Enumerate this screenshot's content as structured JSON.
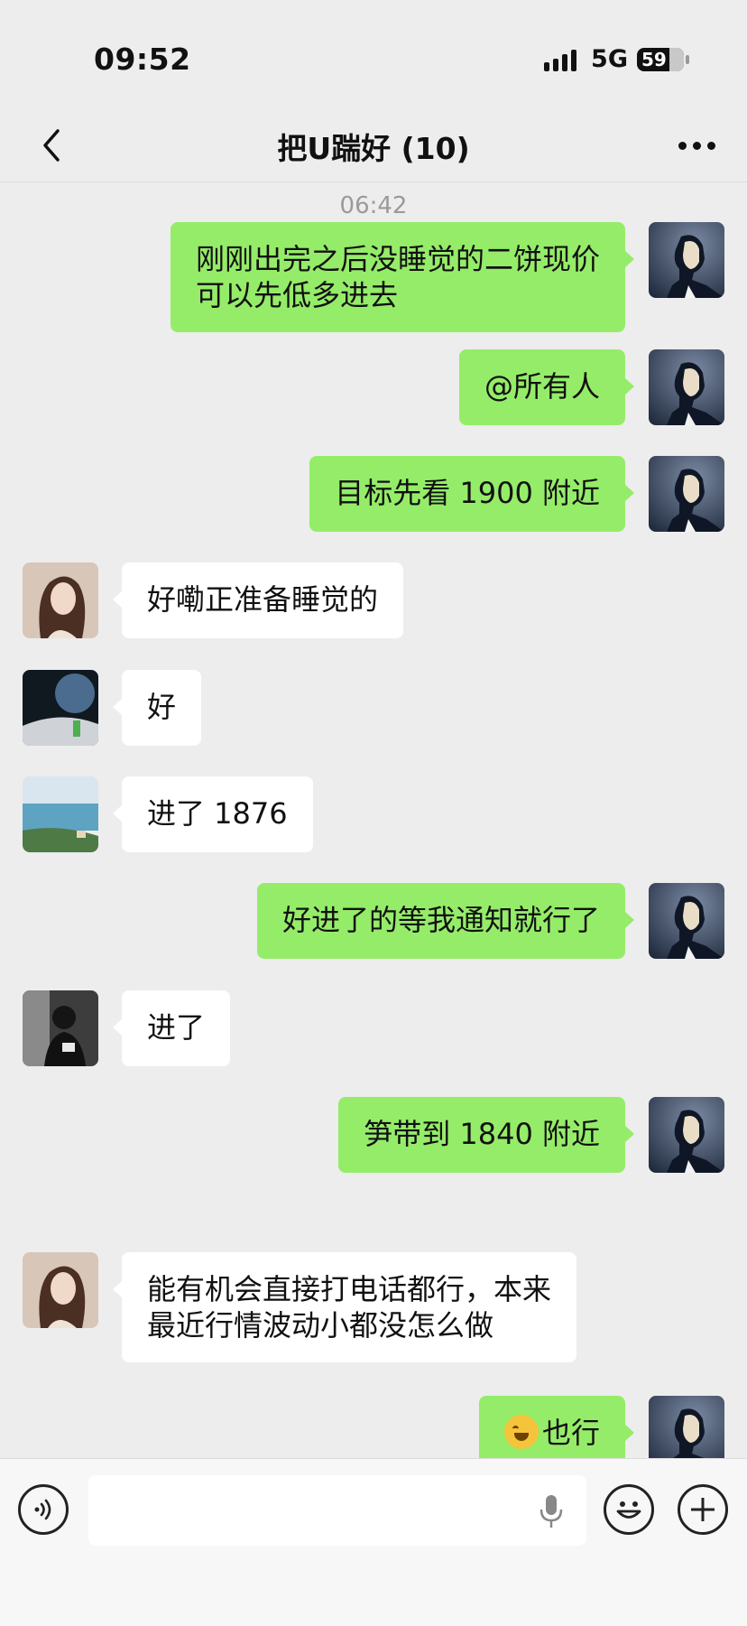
{
  "status_bar": {
    "time": "09:52",
    "network": "5G",
    "battery": "59"
  },
  "header": {
    "title": "把U踹好 (10)"
  },
  "chat": {
    "timestamp": "06:42",
    "messages": [
      {
        "sender": "me",
        "text": "刚刚出完之后没睡觉的二饼现价\n可以先低多进去"
      },
      {
        "sender": "me",
        "text": "@所有人"
      },
      {
        "sender": "me",
        "text": "目标先看 1900 附近"
      },
      {
        "sender": "other",
        "avatar": "girl",
        "text": "好嘞正准备睡觉的"
      },
      {
        "sender": "other",
        "avatar": "space",
        "text": "好"
      },
      {
        "sender": "other",
        "avatar": "sea",
        "text": "进了 1876"
      },
      {
        "sender": "me",
        "text": "好进了的等我通知就行了"
      },
      {
        "sender": "other",
        "avatar": "dark",
        "text": "进了"
      },
      {
        "sender": "me",
        "text": "笋带到 1840 附近"
      },
      {
        "sender": "other",
        "avatar": "girl",
        "text": "能有机会直接打电话都行，本来\n最近行情波动小都没怎么做"
      },
      {
        "sender": "me",
        "emoji": "face-with-tears-of-joy",
        "text": "也行"
      }
    ]
  },
  "input": {
    "value": "",
    "placeholder": ""
  },
  "colors": {
    "background": "#ededed",
    "my_bubble": "#95ec69",
    "other_bubble": "#ffffff"
  }
}
